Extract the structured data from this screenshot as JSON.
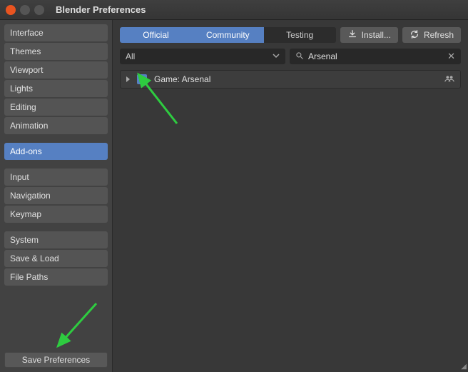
{
  "window": {
    "title": "Blender Preferences"
  },
  "sidebar": {
    "groups": [
      [
        "Interface",
        "Themes",
        "Viewport",
        "Lights",
        "Editing",
        "Animation"
      ],
      [
        "Add-ons"
      ],
      [
        "Input",
        "Navigation",
        "Keymap"
      ],
      [
        "System",
        "Save & Load",
        "File Paths"
      ]
    ],
    "active": "Add-ons",
    "save_label": "Save Preferences"
  },
  "tabs": {
    "items": [
      "Official",
      "Community",
      "Testing"
    ],
    "active": [
      "Official",
      "Community"
    ]
  },
  "buttons": {
    "install": "Install...",
    "refresh": "Refresh"
  },
  "filter": {
    "category": "All",
    "search_value": "Arsenal",
    "search_placeholder": ""
  },
  "addons": [
    {
      "enabled": true,
      "label": "Game: Arsenal"
    }
  ]
}
